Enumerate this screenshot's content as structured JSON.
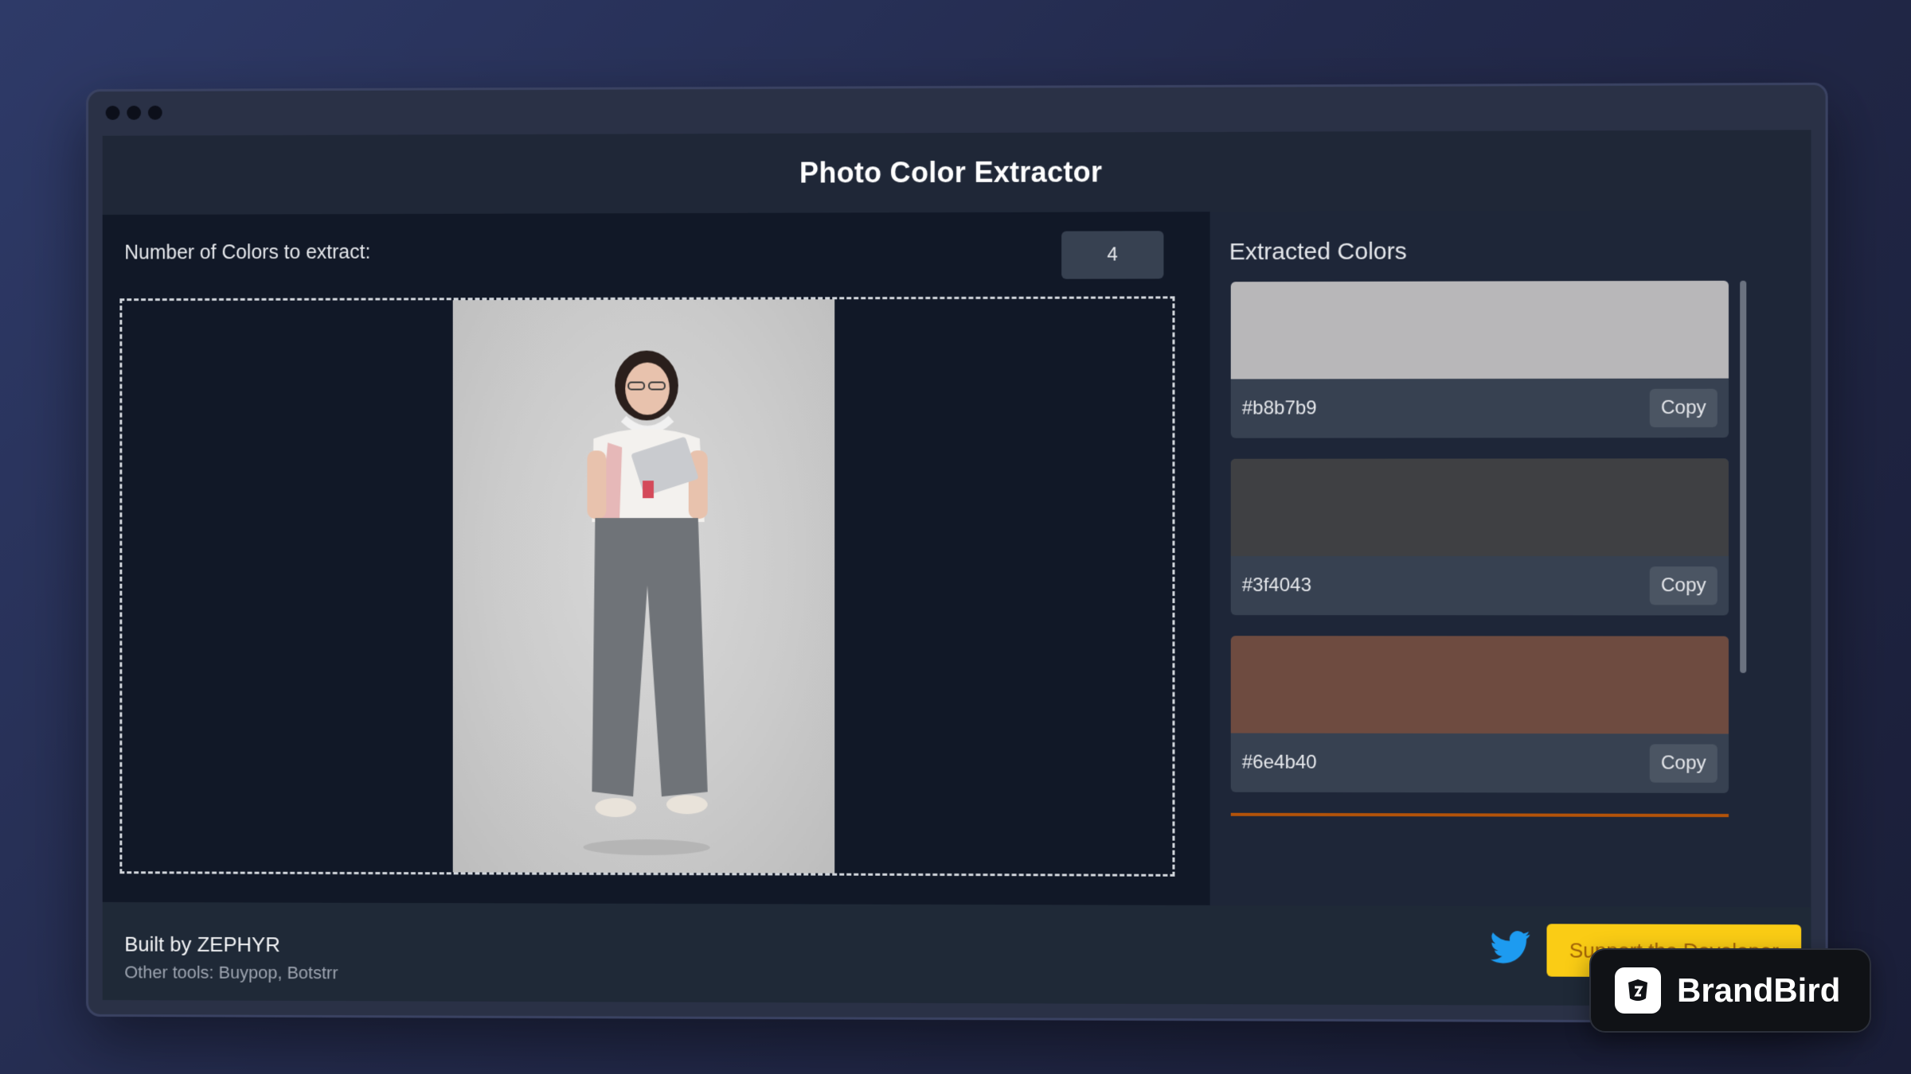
{
  "app": {
    "title": "Photo Color Extractor"
  },
  "controls": {
    "num_colors_label": "Number of Colors to extract:",
    "num_colors_value": "4"
  },
  "upload": {
    "image_alt": "Uploaded photo: woman holding a tablet"
  },
  "extracted": {
    "title": "Extracted Colors",
    "copy_label": "Copy",
    "colors": [
      {
        "hex": "#b8b7b9"
      },
      {
        "hex": "#3f4043"
      },
      {
        "hex": "#6e4b40"
      }
    ]
  },
  "footer": {
    "built_by": "Built by ZEPHYR",
    "other_tools": "Other tools: Buypop, Botstrr",
    "support_button": "Support the Developer"
  },
  "watermark": {
    "brand": "BrandBird"
  },
  "colors": {
    "support_bg": "#facc15",
    "twitter_blue": "#1d9bf0"
  }
}
